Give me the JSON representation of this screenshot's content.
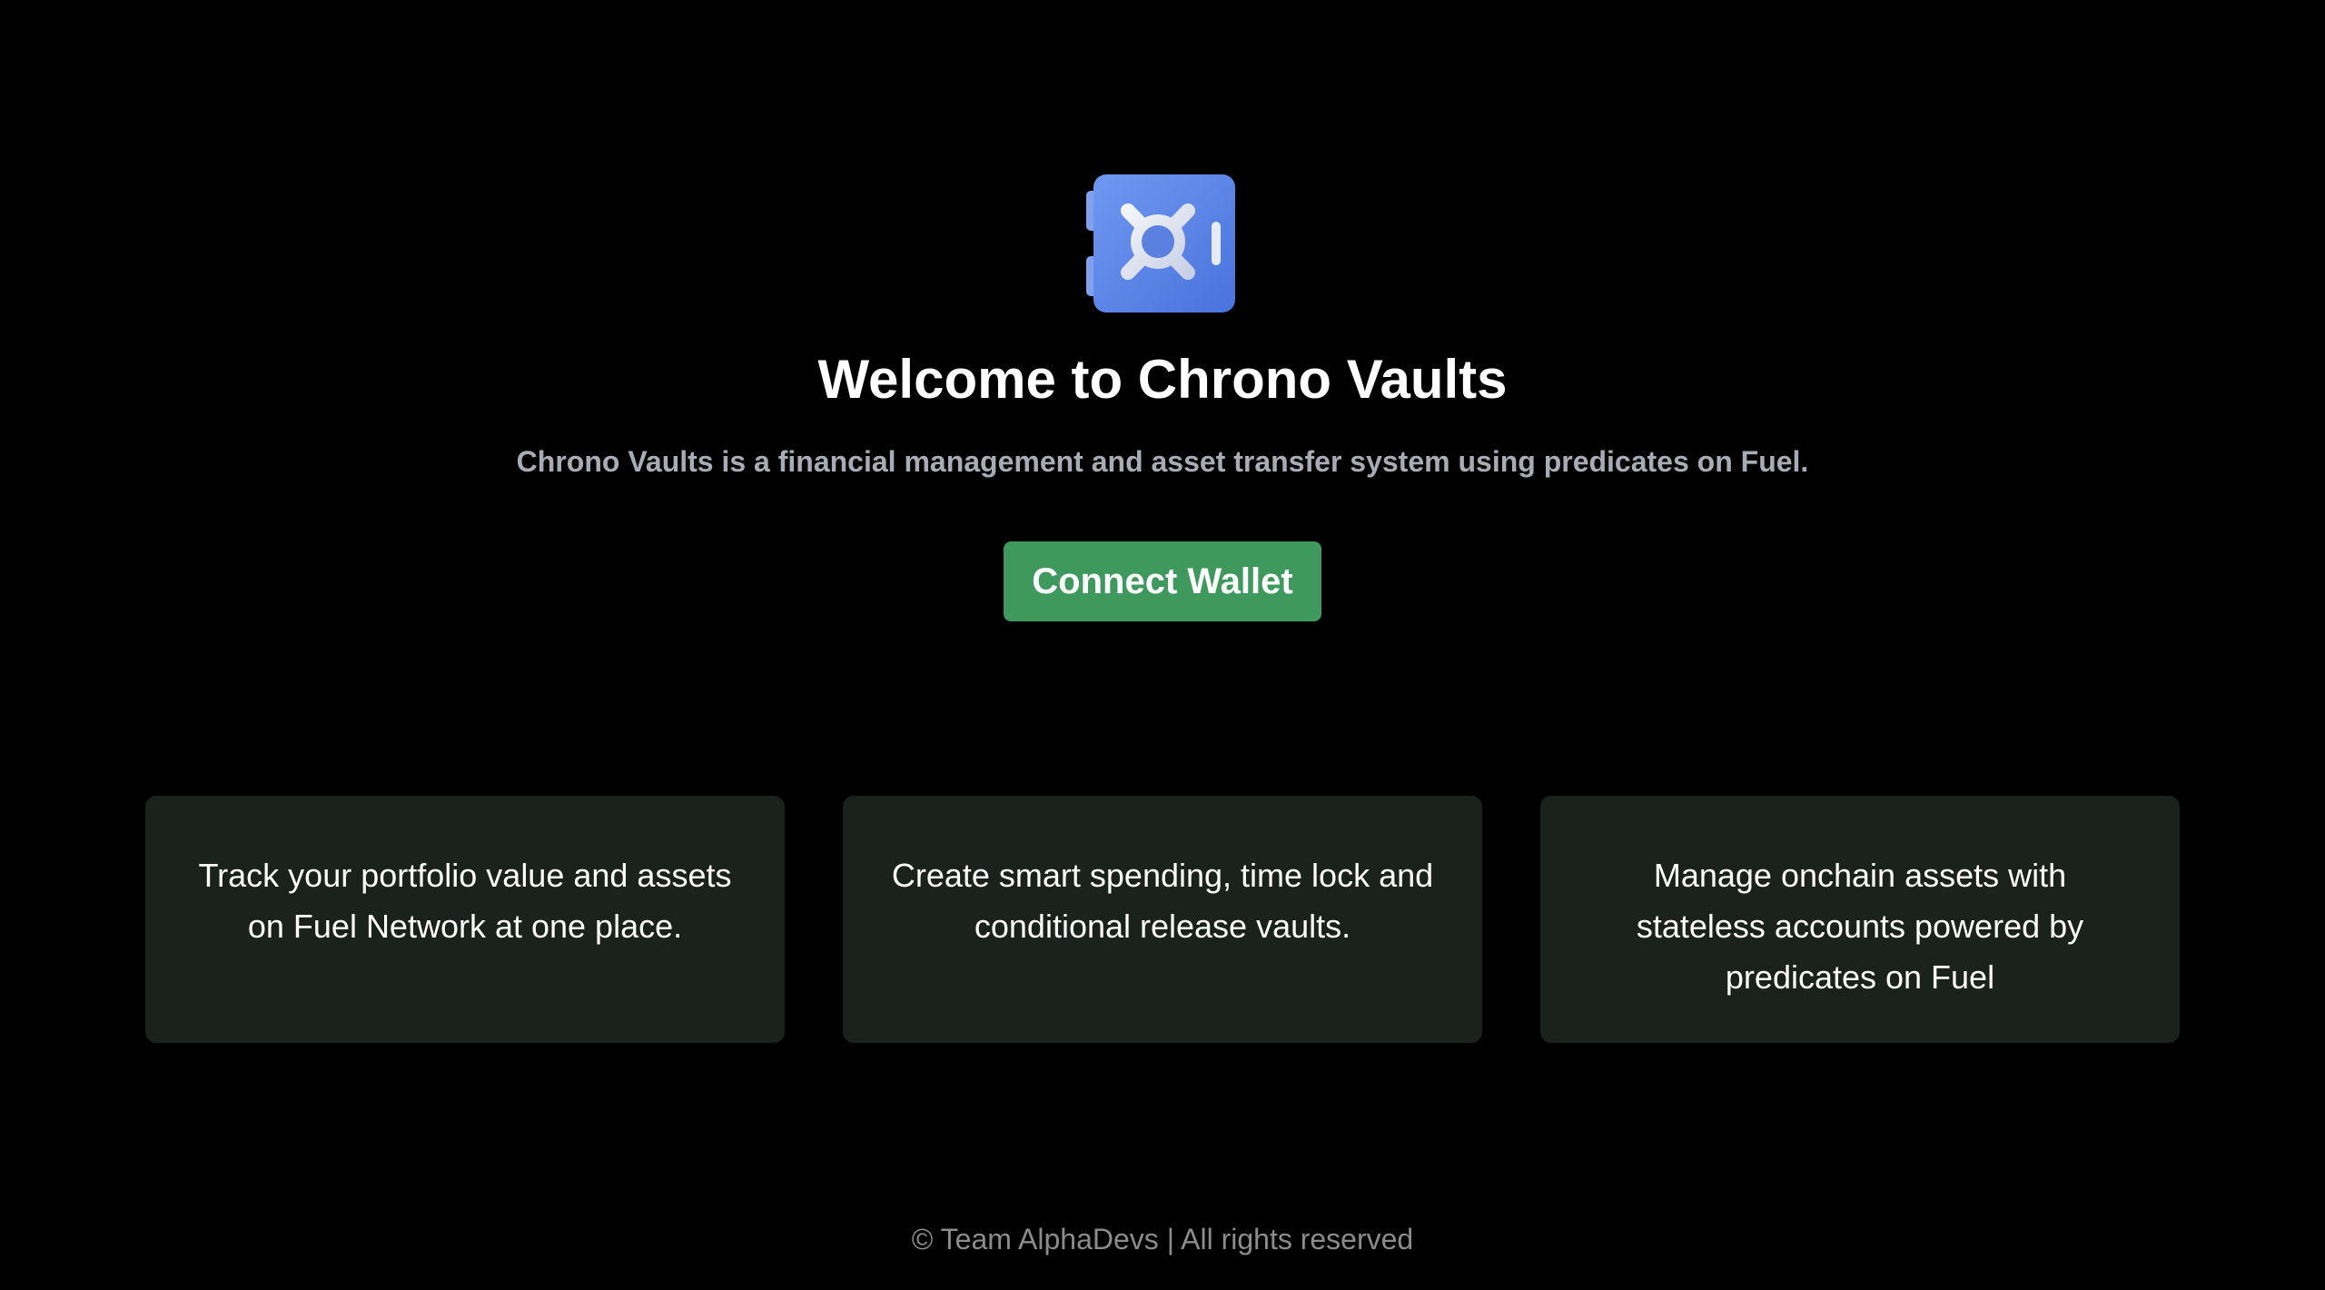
{
  "hero": {
    "logo_icon": "vault-safe-icon",
    "title": "Welcome to Chrono Vaults",
    "subtitle": "Chrono Vaults is a financial management and asset transfer system using predicates on Fuel.",
    "connect_label": "Connect Wallet"
  },
  "features": [
    {
      "text": "Track your portfolio value and assets on Fuel Network at one place."
    },
    {
      "text": "Create smart spending, time lock and conditional release vaults."
    },
    {
      "text": "Manage onchain assets with stateless accounts powered by predicates on Fuel"
    }
  ],
  "footer": {
    "text": "© Team AlphaDevs | All rights reserved"
  },
  "colors": {
    "background": "#000000",
    "accent_button": "#3d9a5c",
    "card_background": "#1b211c",
    "subtitle_text": "#a7acb5",
    "footer_text": "#8c8c8c",
    "logo_blue": "#5b86e6"
  }
}
